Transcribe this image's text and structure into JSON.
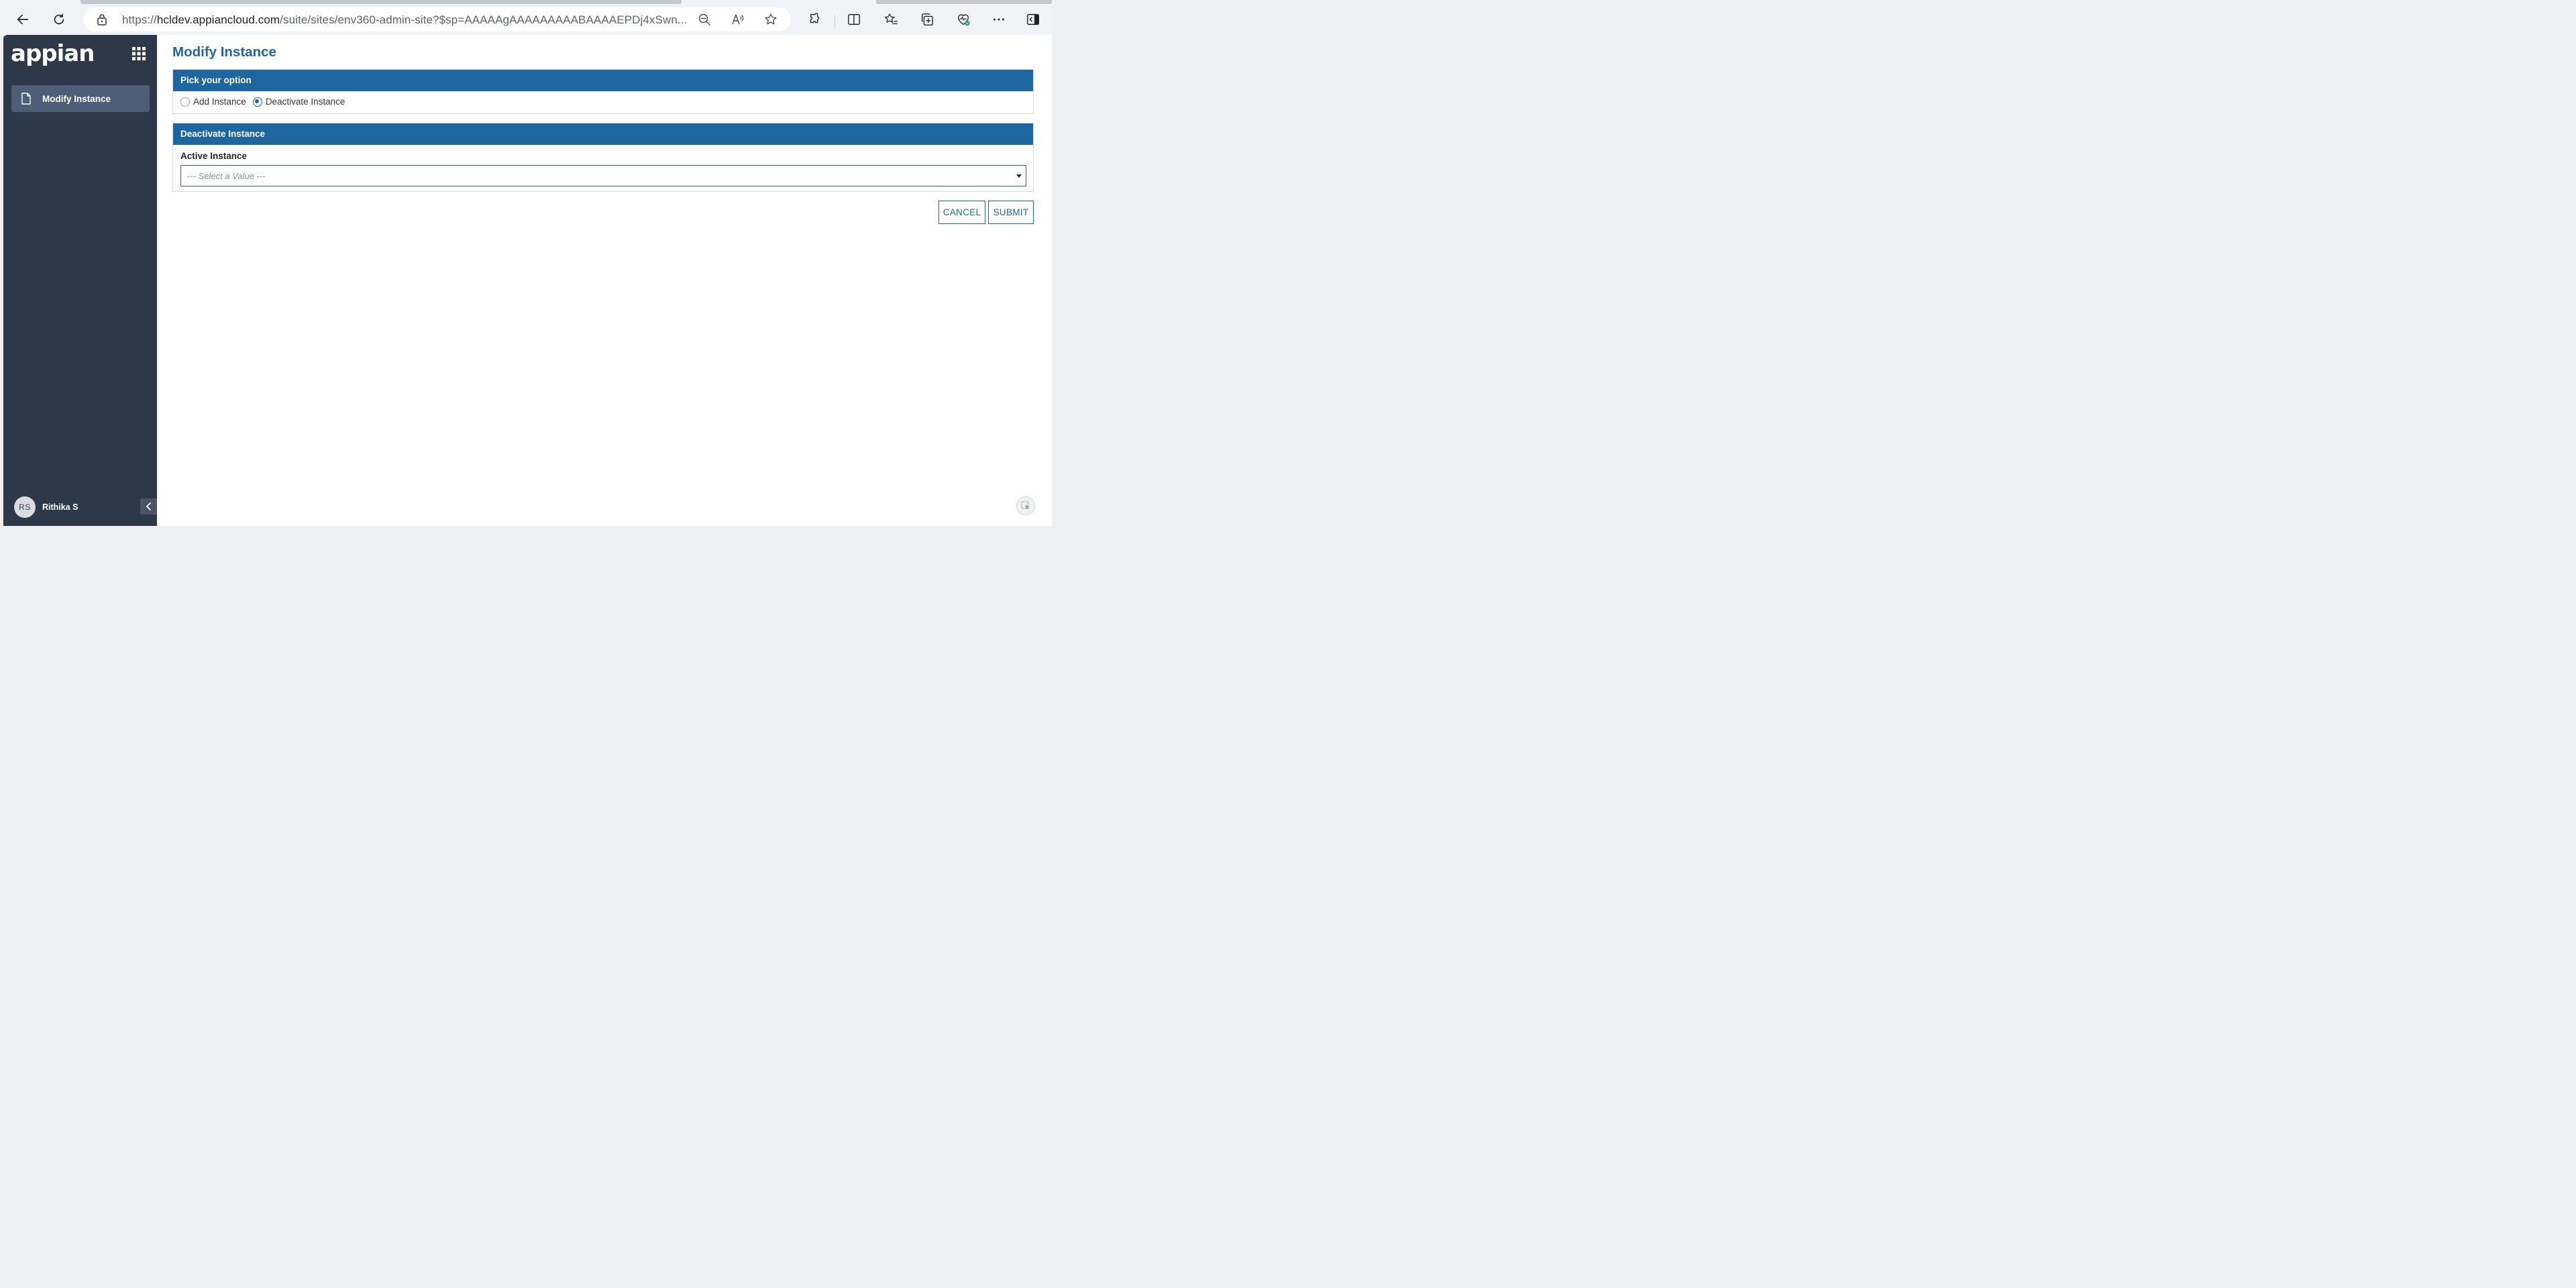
{
  "browser": {
    "url_prefix": "https://",
    "url_host": "hcldev.appiancloud.com",
    "url_path": "/suite/sites/env360-admin-site?$sp=AAAAAgAAAAAAAAABAAAAEPDj4xSwn..."
  },
  "sidebar": {
    "logo_text": "appian",
    "items": [
      {
        "label": "Modify Instance",
        "icon": "document-icon"
      }
    ],
    "user": {
      "initials": "RS",
      "name": "Rithika S"
    }
  },
  "main": {
    "title": "Modify Instance",
    "option_section": {
      "header": "Pick your option",
      "options": [
        {
          "label": "Add Instance",
          "selected": false
        },
        {
          "label": "Deactivate Instance",
          "selected": true
        }
      ]
    },
    "deactivate_section": {
      "header": "Deactivate Instance",
      "field_label": "Active Instance",
      "select_placeholder": "--- Select a Value ---"
    },
    "buttons": {
      "cancel": "CANCEL",
      "submit": "SUBMIT"
    }
  },
  "colors": {
    "sidebar_bg": "#2d3848",
    "nav_active": "#4e5e79",
    "accent": "#1f65a0",
    "title": "#2765a0"
  }
}
